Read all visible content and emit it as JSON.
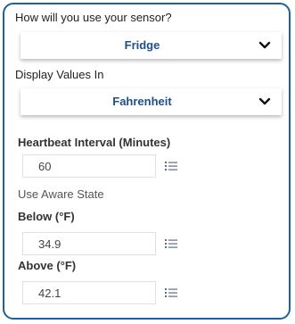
{
  "usage": {
    "question": "How will you use your sensor?",
    "selected": "Fridge",
    "chevron_icon": "chevron-down-icon"
  },
  "display": {
    "label": "Display Values In",
    "selected": "Fahrenheit",
    "chevron_icon": "chevron-down-icon"
  },
  "heartbeat": {
    "label": "Heartbeat Interval (Minutes)",
    "value": "60",
    "icon": "list-icon"
  },
  "aware_state": {
    "label": "Use Aware State"
  },
  "below": {
    "label": "Below (°F)",
    "value": "34.9",
    "icon": "list-icon"
  },
  "above": {
    "label": "Above (°F)",
    "value": "42.1",
    "icon": "list-icon"
  },
  "colors": {
    "border": "#1e5f9c",
    "select_text": "#1f4e8c",
    "icon": "#5a6e85"
  }
}
